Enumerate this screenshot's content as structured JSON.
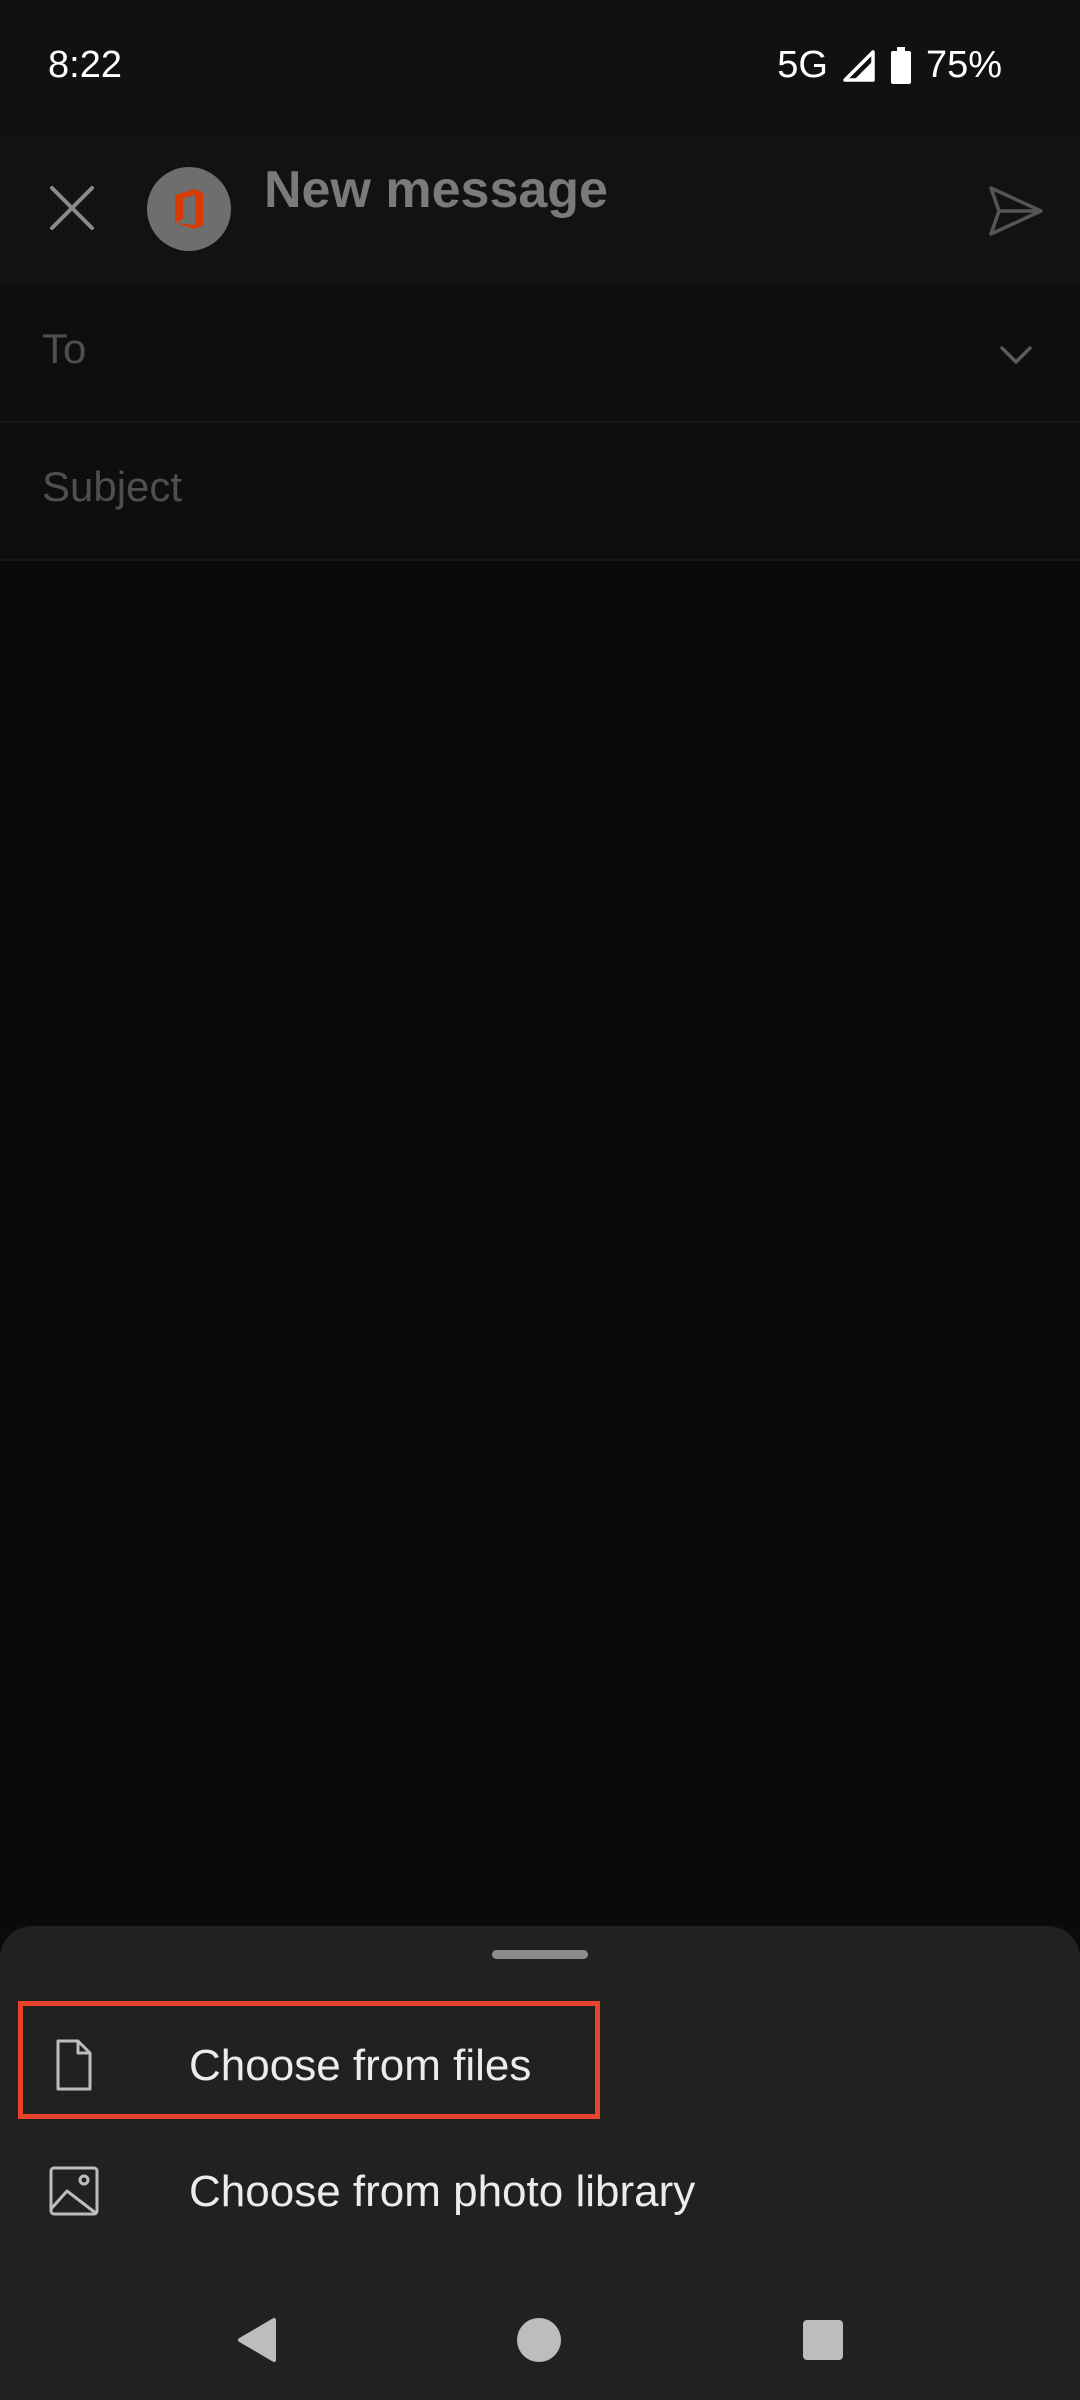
{
  "status_bar": {
    "time": "8:22",
    "network": "5G",
    "battery": "75%",
    "icons": [
      "signal-icon",
      "battery-icon"
    ]
  },
  "header": {
    "title": "New message",
    "icons": [
      "close-icon",
      "office-logo-icon",
      "send-icon"
    ]
  },
  "fields": {
    "to_placeholder": "To",
    "subject_placeholder": "Subject"
  },
  "attachment_sheet": {
    "options": [
      {
        "label": "Choose from files",
        "icon": "file-icon"
      },
      {
        "label": "Choose from photo library",
        "icon": "image-icon"
      }
    ],
    "highlight_color": "#e8432d"
  },
  "nav_bar": {
    "icons": [
      "back-icon",
      "home-icon",
      "recents-icon"
    ]
  },
  "colors": {
    "background": "#0b0b0b",
    "sheet": "#212121",
    "office_red": "#d83b01"
  }
}
